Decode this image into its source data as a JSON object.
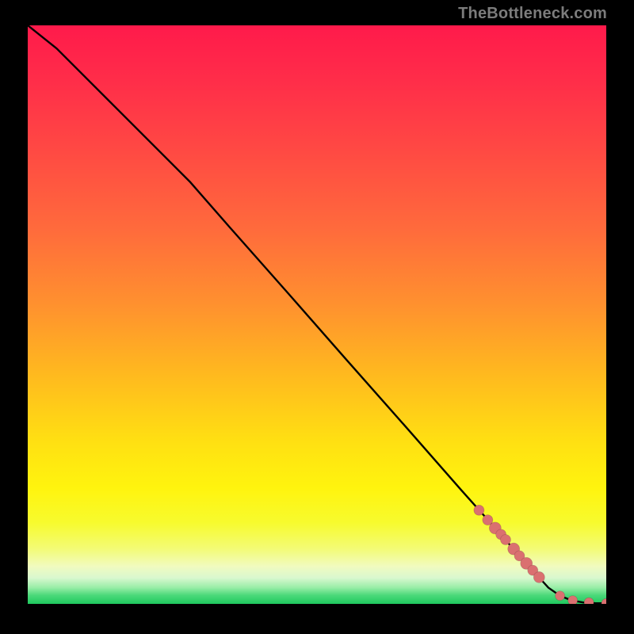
{
  "attribution": "TheBottleneck.com",
  "colors": {
    "background": "#000000",
    "line": "#000000",
    "point_fill": "#da7070",
    "point_stroke": "rgba(0,0,0,0.15)",
    "attribution_text": "#7c7c7c",
    "gradient_stops": [
      {
        "offset": 0.0,
        "color": "#ff1a4b"
      },
      {
        "offset": 0.1,
        "color": "#ff2e49"
      },
      {
        "offset": 0.22,
        "color": "#ff4a43"
      },
      {
        "offset": 0.35,
        "color": "#ff6a3c"
      },
      {
        "offset": 0.48,
        "color": "#ff902f"
      },
      {
        "offset": 0.6,
        "color": "#ffb81f"
      },
      {
        "offset": 0.72,
        "color": "#ffe012"
      },
      {
        "offset": 0.8,
        "color": "#fff40e"
      },
      {
        "offset": 0.86,
        "color": "#f7fb2e"
      },
      {
        "offset": 0.905,
        "color": "#f3fb76"
      },
      {
        "offset": 0.935,
        "color": "#f1fbbf"
      },
      {
        "offset": 0.955,
        "color": "#d9f8cf"
      },
      {
        "offset": 0.972,
        "color": "#98eda6"
      },
      {
        "offset": 0.985,
        "color": "#4cd97a"
      },
      {
        "offset": 1.0,
        "color": "#1fc95e"
      }
    ]
  },
  "chart_data": {
    "type": "line",
    "title": "",
    "xlabel": "",
    "ylabel": "",
    "xlim": [
      0,
      100
    ],
    "ylim": [
      0,
      100
    ],
    "grid": false,
    "legend": false,
    "series": [
      {
        "name": "curve",
        "kind": "line",
        "x": [
          0,
          5,
          10,
          15,
          20,
          25,
          28,
          35,
          45,
          55,
          65,
          75,
          80,
          85,
          88,
          90,
          92,
          94,
          96,
          98,
          100
        ],
        "y": [
          100,
          96,
          91,
          86,
          81,
          76,
          73,
          65,
          53.7,
          42.3,
          31,
          19.6,
          14,
          8.3,
          5,
          2.8,
          1.4,
          0.6,
          0.25,
          0.12,
          0.1
        ]
      },
      {
        "name": "highlight-points",
        "kind": "scatter",
        "x": [
          78.0,
          79.5,
          80.8,
          81.8,
          82.6,
          84.0,
          85.0,
          86.2,
          87.3,
          88.4,
          92.0,
          94.2,
          97.0,
          100.0
        ],
        "y": [
          16.2,
          14.5,
          13.1,
          12.0,
          11.1,
          9.5,
          8.3,
          7.0,
          5.8,
          4.6,
          1.4,
          0.6,
          0.25,
          0.1
        ],
        "r": [
          6.5,
          6.5,
          7.5,
          6.5,
          6.5,
          7.5,
          6.5,
          7.5,
          6.5,
          7.0,
          6.0,
          6.0,
          6.0,
          6.0
        ]
      }
    ]
  }
}
